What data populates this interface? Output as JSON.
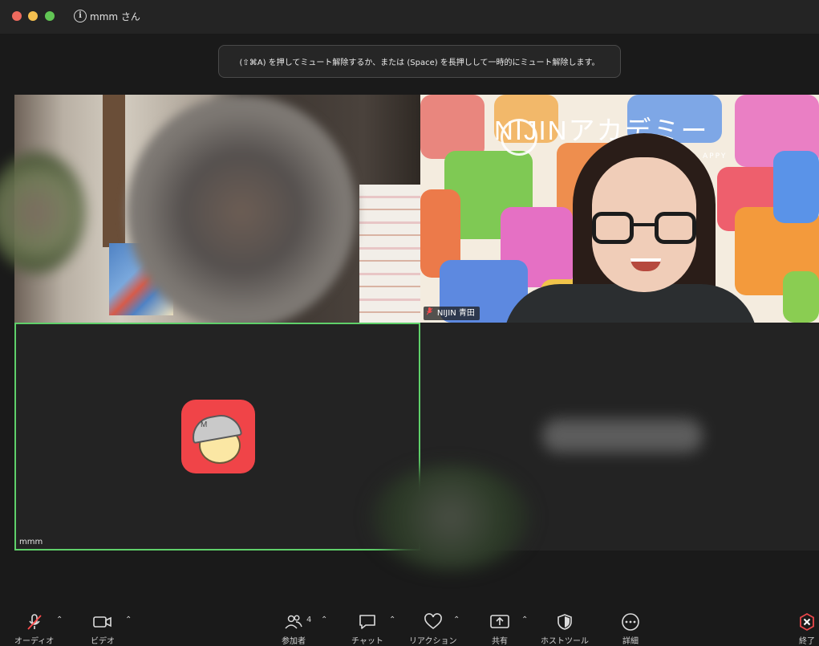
{
  "window": {
    "title": "mmm さん"
  },
  "mute_tip": {
    "text": "(⇧⌘A) を押してミュート解除するか、または (Space) を長押しして一時的にミュート解除します。"
  },
  "video_tiles": {
    "speaker": {
      "name": "NIJIN 青田",
      "muted": true,
      "background_brand": "NIJINアカデミー",
      "background_sub": "APPY"
    },
    "self": {
      "name": "mmm",
      "avatar_letter": "M",
      "active_border_color": "#5fd06a"
    }
  },
  "toolbar": {
    "audio": {
      "label": "オーディオ",
      "muted": true
    },
    "video": {
      "label": "ビデオ"
    },
    "participants": {
      "label": "参加者",
      "count": "4"
    },
    "chat": {
      "label": "チャット"
    },
    "reactions": {
      "label": "リアクション"
    },
    "share": {
      "label": "共有"
    },
    "host_tools": {
      "label": "ホストツール"
    },
    "more": {
      "label": "詳細"
    },
    "end": {
      "label": "終了",
      "color": "#e8464a"
    }
  },
  "colors": {
    "background": "#1a1a1a",
    "titlebar": "#242424",
    "mute_indicator": "#ff4b4b"
  }
}
